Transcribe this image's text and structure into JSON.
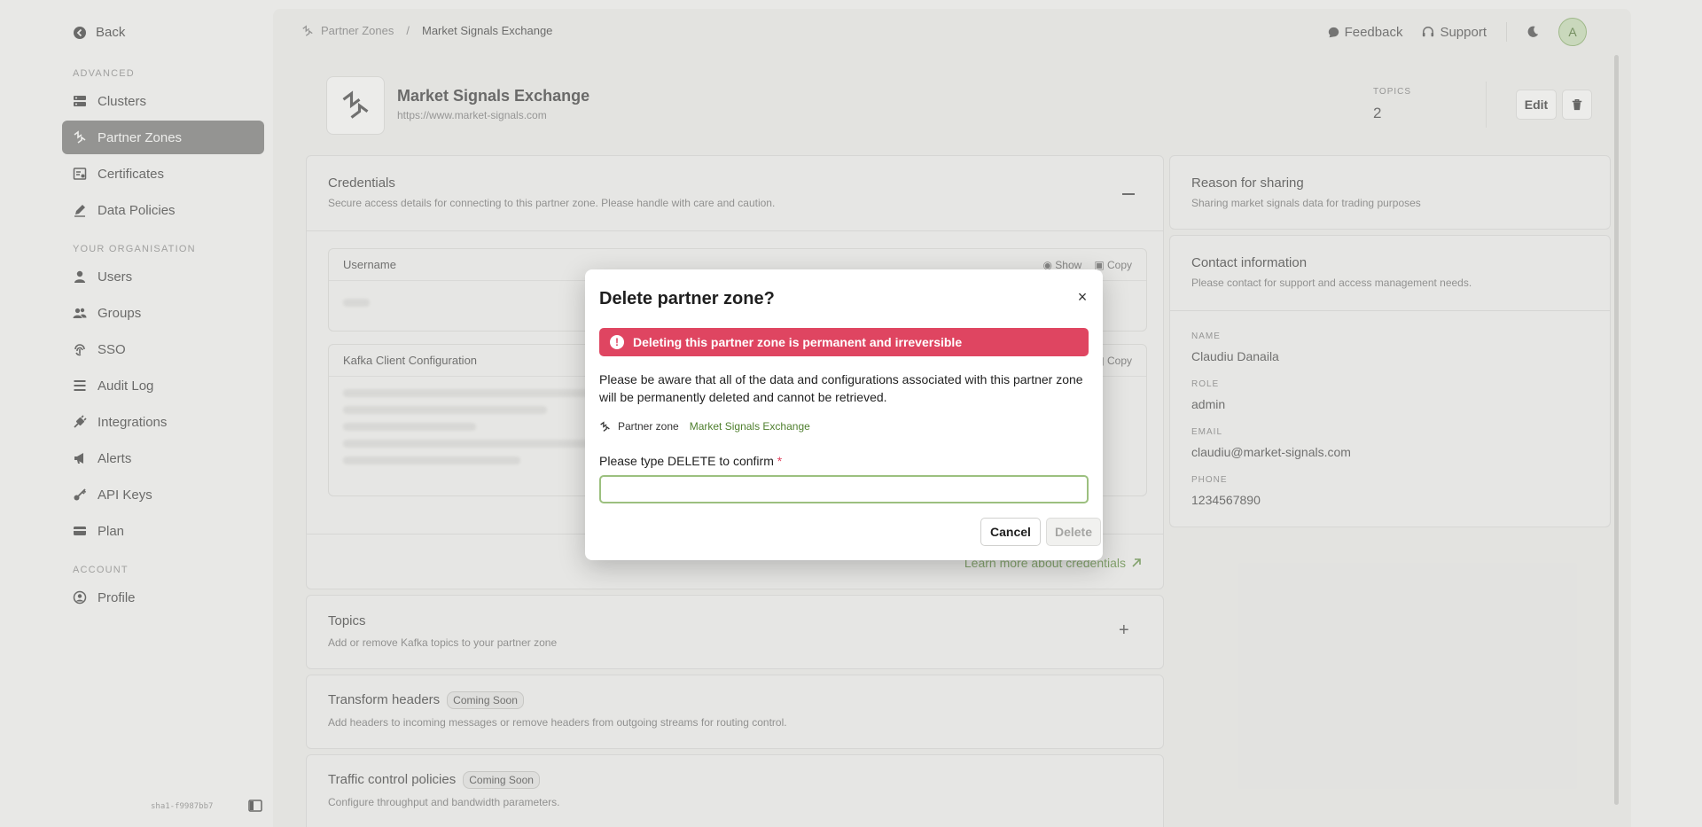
{
  "sidebar": {
    "back_label": "Back",
    "sections": {
      "advanced": "ADVANCED",
      "organisation": "YOUR ORGANISATION",
      "account": "ACCOUNT"
    },
    "items": [
      {
        "label": "Clusters",
        "icon": "server-icon"
      },
      {
        "label": "Partner Zones",
        "icon": "partner-zone-icon",
        "active": true
      },
      {
        "label": "Certificates",
        "icon": "certificate-icon"
      },
      {
        "label": "Data Policies",
        "icon": "pen-icon"
      },
      {
        "label": "Users",
        "icon": "user-icon"
      },
      {
        "label": "Groups",
        "icon": "group-icon"
      },
      {
        "label": "SSO",
        "icon": "fingerprint-icon"
      },
      {
        "label": "Audit Log",
        "icon": "list-icon"
      },
      {
        "label": "Integrations",
        "icon": "plug-icon"
      },
      {
        "label": "Alerts",
        "icon": "megaphone-icon"
      },
      {
        "label": "API Keys",
        "icon": "key-icon"
      },
      {
        "label": "Plan",
        "icon": "card-icon"
      },
      {
        "label": "Profile",
        "icon": "profile-icon"
      }
    ],
    "sha": "sha1-f9987bb7"
  },
  "topbar": {
    "breadcrumb_root": "Partner Zones",
    "breadcrumb_sep": "/",
    "breadcrumb_current": "Market Signals Exchange",
    "feedback": "Feedback",
    "support": "Support",
    "avatar_initial": "A"
  },
  "zone": {
    "name": "Market Signals Exchange",
    "url": "https://www.market-signals.com",
    "topics_label": "TOPICS",
    "topics_count": "2",
    "edit_label": "Edit"
  },
  "credentials": {
    "title": "Credentials",
    "desc": "Secure access details for connecting to this partner zone. Please handle with care and caution.",
    "username_label": "Username",
    "show_label": "Show",
    "copy_label": "Copy",
    "kafka_label": "Kafka Client Configuration",
    "copy_label_2": "Copy",
    "learn_more": "Learn more about credentials"
  },
  "topics": {
    "title": "Topics",
    "desc": "Add or remove Kafka topics to your partner zone"
  },
  "transform": {
    "title": "Transform headers",
    "badge": "Coming Soon",
    "desc": "Add headers to incoming messages or remove headers from outgoing streams for routing control."
  },
  "traffic": {
    "title": "Traffic control policies",
    "badge": "Coming Soon",
    "desc": "Configure throughput and bandwidth parameters."
  },
  "reason": {
    "title": "Reason for sharing",
    "desc": "Sharing market signals data for trading purposes"
  },
  "contact": {
    "title": "Contact information",
    "desc": "Please contact for support and access management needs.",
    "name_label": "NAME",
    "name": "Claudiu Danaila",
    "role_label": "ROLE",
    "role": "admin",
    "email_label": "EMAIL",
    "email": "claudiu@market-signals.com",
    "phone_label": "PHONE",
    "phone": "1234567890"
  },
  "modal": {
    "title": "Delete partner zone?",
    "alert": "Deleting this partner zone is permanent and irreversible",
    "warning": "Please be aware that all of the data and configurations associated with this partner zone will be permanently deleted and cannot be retrieved.",
    "zone_label": "Partner zone",
    "zone_name": "Market Signals Exchange",
    "confirm_label": "Please type DELETE to confirm",
    "required_mark": "*",
    "input_value": "",
    "cancel": "Cancel",
    "delete": "Delete"
  },
  "colors": {
    "accent_green": "#4f7f2e",
    "danger": "#df4561",
    "active_nav": "#6b6b69"
  }
}
